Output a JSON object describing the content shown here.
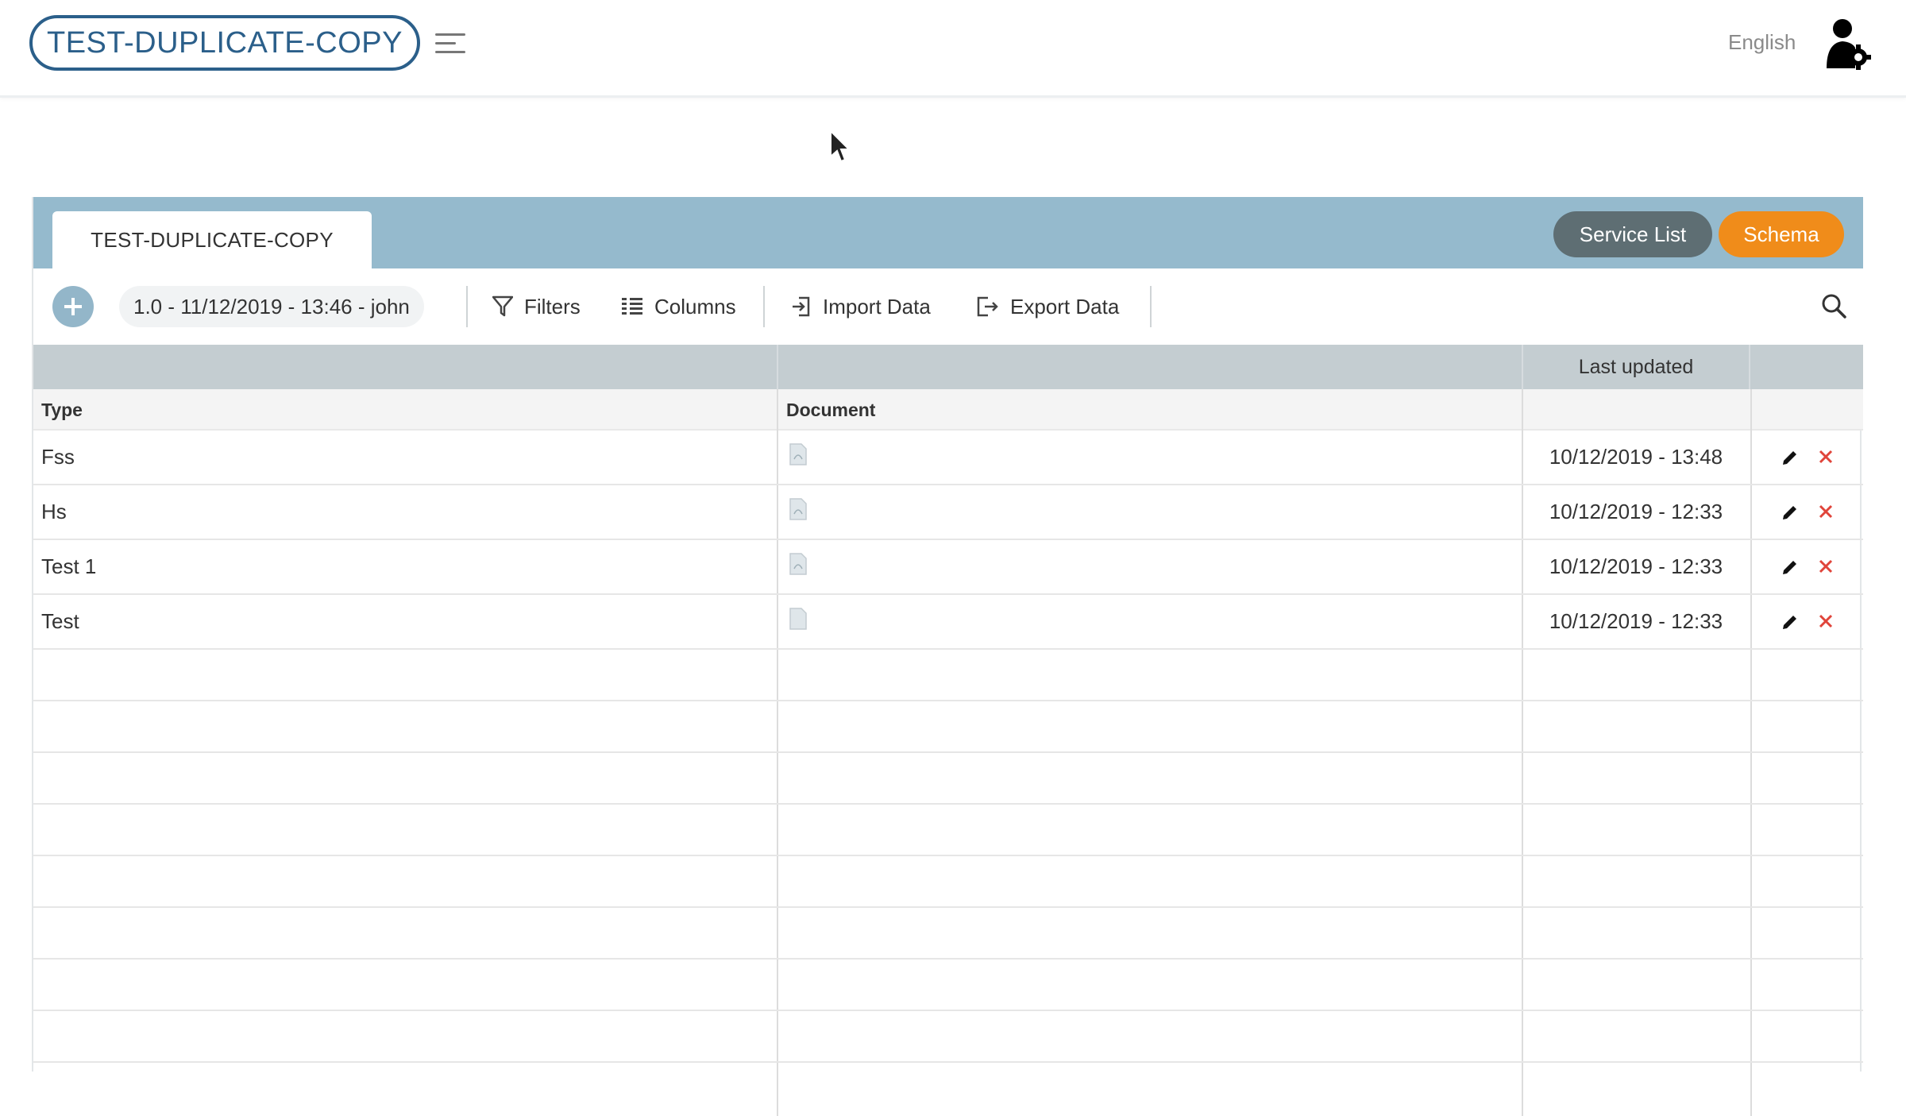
{
  "header": {
    "app_title": "TEST-DUPLICATE-COPY",
    "language": "English"
  },
  "panel": {
    "tab_label": "TEST-DUPLICATE-COPY",
    "service_list_label": "Service List",
    "schema_label": "Schema",
    "colors": {
      "header_bg": "#95bacd",
      "service_btn": "#5e6e73",
      "schema_btn": "#f08c1a"
    }
  },
  "toolbar": {
    "version": "1.0 - 11/12/2019 - 13:46 - john",
    "filters": "Filters",
    "columns": "Columns",
    "import": "Import Data",
    "export": "Export Data"
  },
  "grid": {
    "group_header": "Last updated",
    "columns": [
      "Type",
      "Document"
    ],
    "rows": [
      {
        "type": "Fss",
        "document_icon": "pdf-file-icon",
        "last_updated": "10/12/2019 - 13:48"
      },
      {
        "type": "Hs",
        "document_icon": "pdf-file-icon",
        "last_updated": "10/12/2019 - 12:33"
      },
      {
        "type": "Test 1",
        "document_icon": "pdf-file-icon",
        "last_updated": "10/12/2019 - 12:33"
      },
      {
        "type": "Test",
        "document_icon": "file-icon",
        "last_updated": "10/12/2019 - 12:33"
      }
    ]
  }
}
